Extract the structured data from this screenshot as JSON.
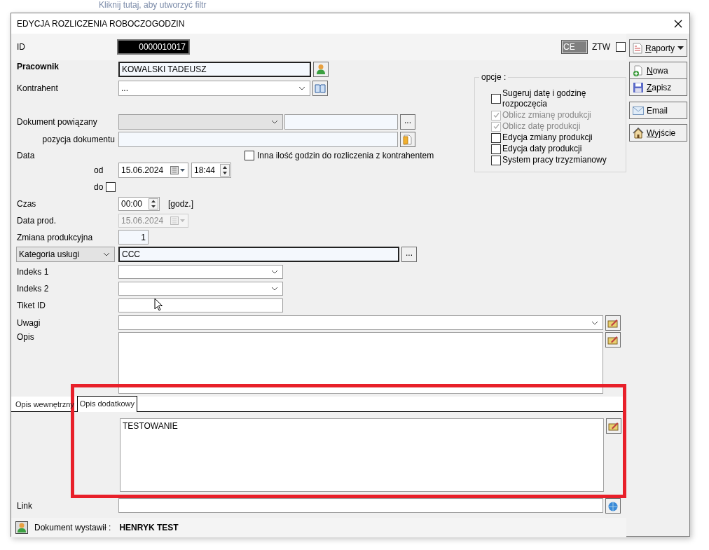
{
  "background_hint": "Kliknij tutaj, aby utworzyć filtr",
  "window": {
    "title": "EDYCJA ROZLICZENIA ROBOCZOGODZIN"
  },
  "header": {
    "id_label": "ID",
    "id_value": "0000010017",
    "code_value": "CE",
    "ztw_label": "ZTW",
    "ztw_checked": false
  },
  "employee": {
    "label": "Pracownik",
    "value": "KOWALSKI TADEUSZ"
  },
  "contractor": {
    "label": "Kontrahent",
    "value": "..."
  },
  "related_document": {
    "label": "Dokument powiązany",
    "disabled": true,
    "browse": "..."
  },
  "document_position": {
    "label": "pozycja dokumentu"
  },
  "date": {
    "label": "Data",
    "other_hours_label": "Inna ilość godzin do rozliczenia z kontrahentem",
    "other_hours_checked": false,
    "from_label": "od",
    "from_date": "15.06.2024",
    "from_time": "18:44",
    "to_label": "do",
    "to_checked": false
  },
  "time": {
    "label": "Czas",
    "value": "00:00",
    "unit": "[godz.]"
  },
  "production_date": {
    "label": "Data prod.",
    "value": "15.06.2024",
    "disabled": true
  },
  "production_shift": {
    "label": "Zmiana produkcyjna",
    "value": "1"
  },
  "category": {
    "selector": "Kategoria usługi",
    "value": "CCC",
    "browse": "..."
  },
  "index_1": {
    "label": "Indeks 1"
  },
  "index_2": {
    "label": "Indeks 2"
  },
  "ticket": {
    "label": "Tiket ID"
  },
  "remarks": {
    "label": "Uwagi"
  },
  "description": {
    "label": "Opis"
  },
  "tabs": [
    {
      "label": "Opis wewnętrzny",
      "selected": false
    },
    {
      "label": "Opis dodatkowy",
      "selected": true
    }
  ],
  "tab_content": "TESTOWANIE",
  "link": {
    "label": "Link"
  },
  "footer": {
    "label": "Dokument wystawił :",
    "value": "HENRYK TEST"
  },
  "options": {
    "title": "opcje :",
    "items": [
      {
        "label": "Sugeruj datę i godzinę rozpoczęcia",
        "checked": false,
        "disabled": false
      },
      {
        "label": "Oblicz zmianę produkcji",
        "checked": true,
        "disabled": true
      },
      {
        "label": "Oblicz datę produkcji",
        "checked": true,
        "disabled": true
      },
      {
        "label": "Edycja zmiany produkcji",
        "checked": false,
        "disabled": false
      },
      {
        "label": "Edycja daty produkcji",
        "checked": false,
        "disabled": false
      },
      {
        "label": "System pracy trzyzmianowy",
        "checked": false,
        "disabled": false
      }
    ]
  },
  "buttons": [
    {
      "label": "Raporty",
      "kind": "reports",
      "underlined": true
    },
    {
      "label": "Nowa",
      "kind": "new",
      "underlined": true
    },
    {
      "label": "Zapisz",
      "kind": "save",
      "underlined": true
    },
    {
      "label": "Email",
      "kind": "email",
      "underlined": false
    },
    {
      "label": "Wyjście",
      "kind": "exit",
      "underlined": true
    }
  ]
}
